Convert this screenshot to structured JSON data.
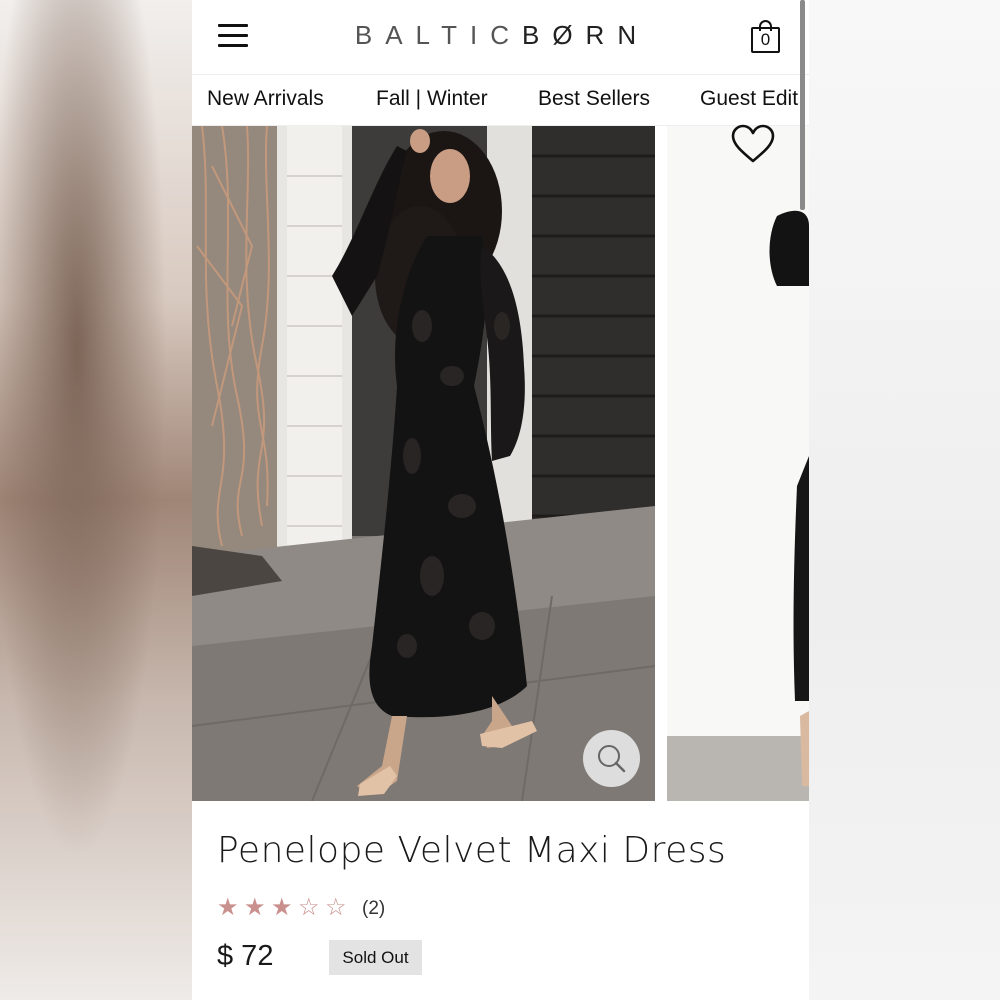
{
  "header": {
    "logo_part1": "BALTIC",
    "logo_part2": "BØRN",
    "cart_count": "0"
  },
  "nav": {
    "items": [
      "New Arrivals",
      "Fall | Winter",
      "Best Sellers",
      "Guest Edit"
    ]
  },
  "product": {
    "title": "Penelope Velvet Maxi Dress",
    "rating": 3,
    "rating_max": 5,
    "review_count": "(2)",
    "price": "$ 72",
    "status": "Sold Out"
  },
  "icons": {
    "menu": "hamburger-menu-icon",
    "cart": "shopping-bag-icon",
    "favorite": "heart-icon",
    "zoom": "magnifier-icon"
  },
  "colors": {
    "star": "#c9908e",
    "badge_bg": "#e3e3e3",
    "text": "#1a1a1a"
  }
}
